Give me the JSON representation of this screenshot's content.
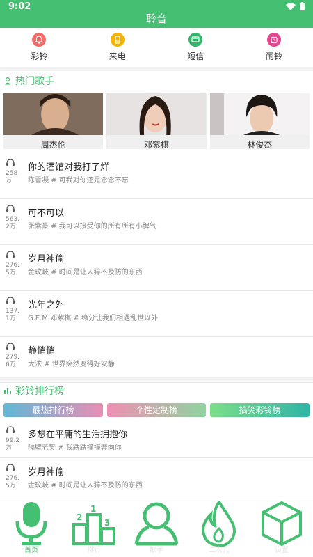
{
  "status_bar": {
    "time": "9:02"
  },
  "app": {
    "title": "聆音"
  },
  "categories": [
    {
      "label": "彩铃",
      "color": "#f26b6b",
      "icon": "bell-icon"
    },
    {
      "label": "来电",
      "color": "#f5b300",
      "icon": "phone-icon"
    },
    {
      "label": "短信",
      "color": "#34b36b",
      "icon": "message-icon"
    },
    {
      "label": "闹铃",
      "color": "#e3468f",
      "icon": "alarm-icon"
    }
  ],
  "hot_singers": {
    "title": "热门歌手",
    "items": [
      {
        "name": "周杰伦"
      },
      {
        "name": "邓紫棋"
      },
      {
        "name": "林俊杰"
      }
    ]
  },
  "songs": [
    {
      "hot": "258万",
      "title": "你的酒馆对我打了烊",
      "sub": "陈雪凝 # 可我对你还是念念不忘"
    },
    {
      "hot": "563.2万",
      "title": "可不可以",
      "sub": "张紫豪 # 我可以接受你的所有所有小脾气"
    },
    {
      "hot": "276.5万",
      "title": "岁月神偷",
      "sub": "金玟岐 # 时间是让人猝不及防的东西"
    },
    {
      "hot": "137.1万",
      "title": "光年之外",
      "sub": "G.E.M.邓紫棋 # 缘分让我们相遇乱世以外"
    },
    {
      "hot": "279.6万",
      "title": "静悄悄",
      "sub": "大泫 # 世界突然变得好安静"
    }
  ],
  "ranking": {
    "title": "彩铃排行榜",
    "tabs": [
      {
        "label": "最热排行榜"
      },
      {
        "label": "个性定制榜"
      },
      {
        "label": "搞笑彩铃榜"
      }
    ],
    "songs": [
      {
        "hot": "99.2万",
        "title": "多想在平庸的生活拥抱你",
        "sub": "隔壁老樊 # 我跌跌撞撞奔向你"
      },
      {
        "hot": "276.5万",
        "title": "岁月神偷",
        "sub": "金玟岐 # 时间是让人猝不及防的东西"
      }
    ]
  },
  "bottom_nav": [
    {
      "label": "首页",
      "icon": "microphone-icon",
      "active": true
    },
    {
      "label": "排行",
      "icon": "podium-icon",
      "active": false
    },
    {
      "label": "歌手",
      "icon": "singer-icon",
      "active": false
    },
    {
      "label": "二次元",
      "icon": "flame-icon",
      "active": false
    },
    {
      "label": "设置",
      "icon": "cube-icon",
      "active": false
    }
  ],
  "colors": {
    "accent": "#45c073",
    "tab_gradients": [
      "#5fb8d6,#e98fb4",
      "#f08fb3,#8fd39f",
      "#7cde8a,#2fb5a5"
    ]
  }
}
